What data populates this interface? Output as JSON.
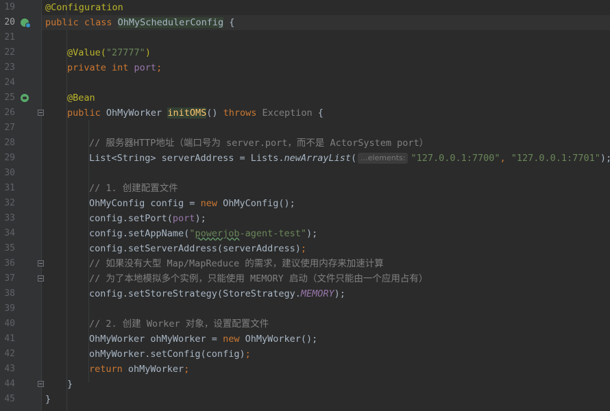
{
  "editor": {
    "lines": [
      {
        "n": "19",
        "t": "@Configuration"
      },
      {
        "n": "20",
        "t1": "public class ",
        "t2": "OhMySchedulerConfig",
        "t3": " {"
      },
      {
        "n": "21"
      },
      {
        "n": "22",
        "t1": "@Value(",
        "t2": "\"27777\"",
        "t3": ")"
      },
      {
        "n": "23",
        "t1": "private int ",
        "t2": "port",
        "t3": ";"
      },
      {
        "n": "24"
      },
      {
        "n": "25",
        "t": "@Bean"
      },
      {
        "n": "26",
        "t1": "public ",
        "t2": "OhMyWorker ",
        "t3": "initOMS",
        "t4": "() ",
        "t5": "throws",
        "t6": " Exception",
        "t7": " {"
      },
      {
        "n": "27"
      },
      {
        "n": "28",
        "t": "// 服务器HTTP地址（端口号为 server.port，而不是 ActorSystem port）"
      },
      {
        "n": "29",
        "t1": "List<String> serverAddress = Lists.",
        "t2": "newArrayList",
        "t3": "(",
        "hint": "...elements:",
        "t4": "\"127.0.0.1:7700\"",
        "t5": ", ",
        "t6": "\"127.0.0.1:7701\"",
        "t7": ");"
      },
      {
        "n": "30"
      },
      {
        "n": "31",
        "t": "// 1. 创建配置文件"
      },
      {
        "n": "32",
        "t1": "OhMyConfig config = ",
        "t2": "new ",
        "t3": "OhMyConfig();"
      },
      {
        "n": "33",
        "t1": "config.setPort(",
        "t2": "port",
        "t3": ");"
      },
      {
        "n": "34",
        "t1": "config.setAppName(",
        "t2": "\"",
        "t3": "powerjob",
        "t4": "-agent-test\"",
        "t5": ");"
      },
      {
        "n": "35",
        "t1": "config.setServerAddress(serverAddress)",
        "t2": ";"
      },
      {
        "n": "36",
        "t": "// 如果没有大型 Map/MapReduce 的需求，建议使用内存来加速计算"
      },
      {
        "n": "37",
        "t": "// 为了本地模拟多个实例，只能使用 MEMORY 启动（文件只能由一个应用占有）"
      },
      {
        "n": "38",
        "t1": "config.setStoreStrategy(StoreStrategy.",
        "t2": "MEMORY",
        "t3": ");"
      },
      {
        "n": "39"
      },
      {
        "n": "40",
        "t": "// 2. 创建 Worker 对象，设置配置文件"
      },
      {
        "n": "41",
        "t1": "OhMyWorker ohMyWorker = ",
        "t2": "new ",
        "t3": "OhMyWorker();"
      },
      {
        "n": "42",
        "t1": "ohMyWorker.setConfig(config)",
        "t2": ";"
      },
      {
        "n": "43",
        "t1": "return ",
        "t2": "ohMyWorker",
        "t3": ";"
      },
      {
        "n": "44",
        "t": "}"
      },
      {
        "n": "45",
        "t": "}"
      }
    ]
  },
  "colors": {
    "background": "#2b2b2b",
    "gutter": "#313335",
    "keyword": "#cc7832",
    "annotation": "#bbb529",
    "string": "#6a8759",
    "field": "#9876aa",
    "comment": "#808080",
    "method_decl": "#ffc66d",
    "text": "#a9b7c6"
  },
  "icons": {
    "line20": "run-config-icon",
    "line25": "spring-bean-icon"
  }
}
